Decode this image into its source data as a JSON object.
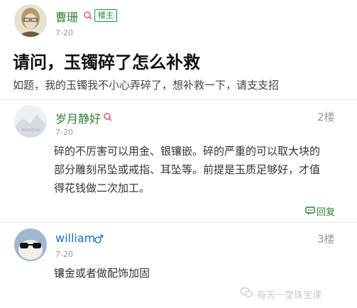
{
  "op": {
    "name": "曹珊",
    "badge": "楼主",
    "date": "7-20",
    "title": "请问，玉镯碎了怎么补救",
    "body": "如题，我的玉镯我不小心弄碎了，想补救一下，请支支招"
  },
  "replies": [
    {
      "name": "岁月静好",
      "floor": "2楼",
      "date": "7-20",
      "lines": [
        "碎的不厉害可以用金、银镶嵌。碎的严重的可以取大块的",
        "部分雕刻吊坠或戒指、耳坠等。前提是玉质足够好，才值",
        "得花钱做二次加工。"
      ],
      "reply_label": "回复"
    },
    {
      "name": "william",
      "floor": "3楼",
      "date": "7-20",
      "lines": [
        "镶金或者做配饰加固"
      ]
    }
  ],
  "watermark": "每天一堂珠宝课",
  "colors": {
    "accent_green": "#2e7d32",
    "link_blue": "#1d6fb8",
    "female_icon": "#e05a7a",
    "male_icon": "#2b7bd6"
  },
  "icons": [
    "female-gender-icon",
    "male-gender-icon",
    "comment-icon",
    "wechat-icon"
  ]
}
